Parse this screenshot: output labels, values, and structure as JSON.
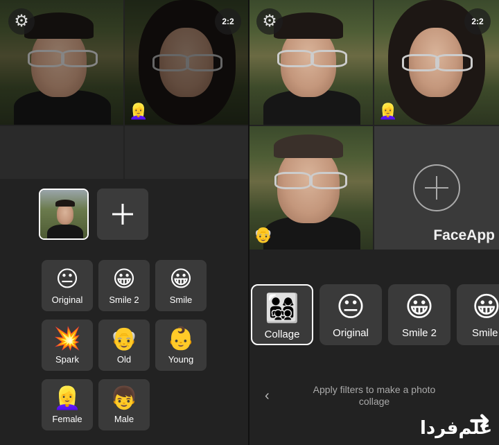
{
  "left": {
    "top_buttons": {
      "settings_icon": "gear-icon",
      "layout_label": "2:2"
    },
    "add_label": "+",
    "filters": [
      {
        "emoji": "😐",
        "label": "Original"
      },
      {
        "emoji": "😀",
        "label": "Smile 2"
      },
      {
        "emoji": "😀",
        "label": "Smile"
      },
      {
        "emoji": "💥",
        "label": "Spark"
      },
      {
        "emoji": "👴",
        "label": "Old"
      },
      {
        "emoji": "👶",
        "label": "Young"
      },
      {
        "emoji": "👱‍♀️",
        "label": "Female"
      },
      {
        "emoji": "👦",
        "label": "Male"
      }
    ]
  },
  "right": {
    "top_buttons": {
      "settings_icon": "gear-icon",
      "layout_label": "2:2"
    },
    "badge_female": "👱‍♀️",
    "badge_old": "👴",
    "watermark": "FaceApp",
    "filters": [
      {
        "emoji": "👨‍👩‍👧‍👦",
        "label": "Collage"
      },
      {
        "emoji": "😐",
        "label": "Original"
      },
      {
        "emoji": "😀",
        "label": "Smile 2"
      },
      {
        "emoji": "😀",
        "label": "Smile"
      }
    ],
    "hint": "Apply filters to make a photo collage",
    "back_icon": "‹"
  },
  "logo_text": "علم‌فردا"
}
